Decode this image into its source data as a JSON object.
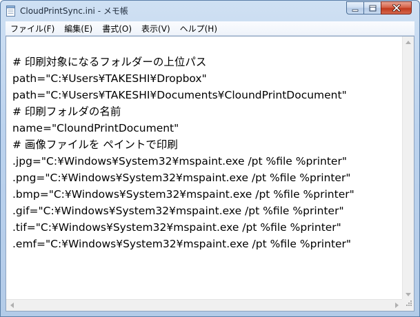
{
  "window": {
    "title": "CloudPrintSync.ini - メモ帳"
  },
  "menu": {
    "items": [
      {
        "label": "ファイル(F)"
      },
      {
        "label": "編集(E)"
      },
      {
        "label": "書式(O)"
      },
      {
        "label": "表示(V)"
      },
      {
        "label": "ヘルプ(H)"
      }
    ]
  },
  "editor": {
    "lines": [
      "",
      "# 印刷対象になるフォルダーの上位パス",
      "path=\"C:¥Users¥TAKESHI¥Dropbox\"",
      "path=\"C:¥Users¥TAKESHI¥Documents¥CloundPrintDocument\"",
      "# 印刷フォルダの名前",
      "name=\"CloundPrintDocument\"",
      "# 画像ファイルを ペイントで印刷",
      ".jpg=\"C:¥Windows¥System32¥mspaint.exe /pt %file %printer\"",
      ".png=\"C:¥Windows¥System32¥mspaint.exe /pt %file %printer\"",
      ".bmp=\"C:¥Windows¥System32¥mspaint.exe /pt %file %printer\"",
      ".gif=\"C:¥Windows¥System32¥mspaint.exe /pt %file %printer\"",
      ".tif=\"C:¥Windows¥System32¥mspaint.exe /pt %file %printer\"",
      ".emf=\"C:¥Windows¥System32¥mspaint.exe /pt %file %printer\""
    ]
  },
  "icons": {
    "app": "notepad-icon",
    "minimize": "minimize-icon",
    "maximize": "maximize-icon",
    "close": "close-icon"
  },
  "colors": {
    "close_button": "#c13a1e",
    "title_bar": "#bcd3ee",
    "text": "#000000"
  }
}
